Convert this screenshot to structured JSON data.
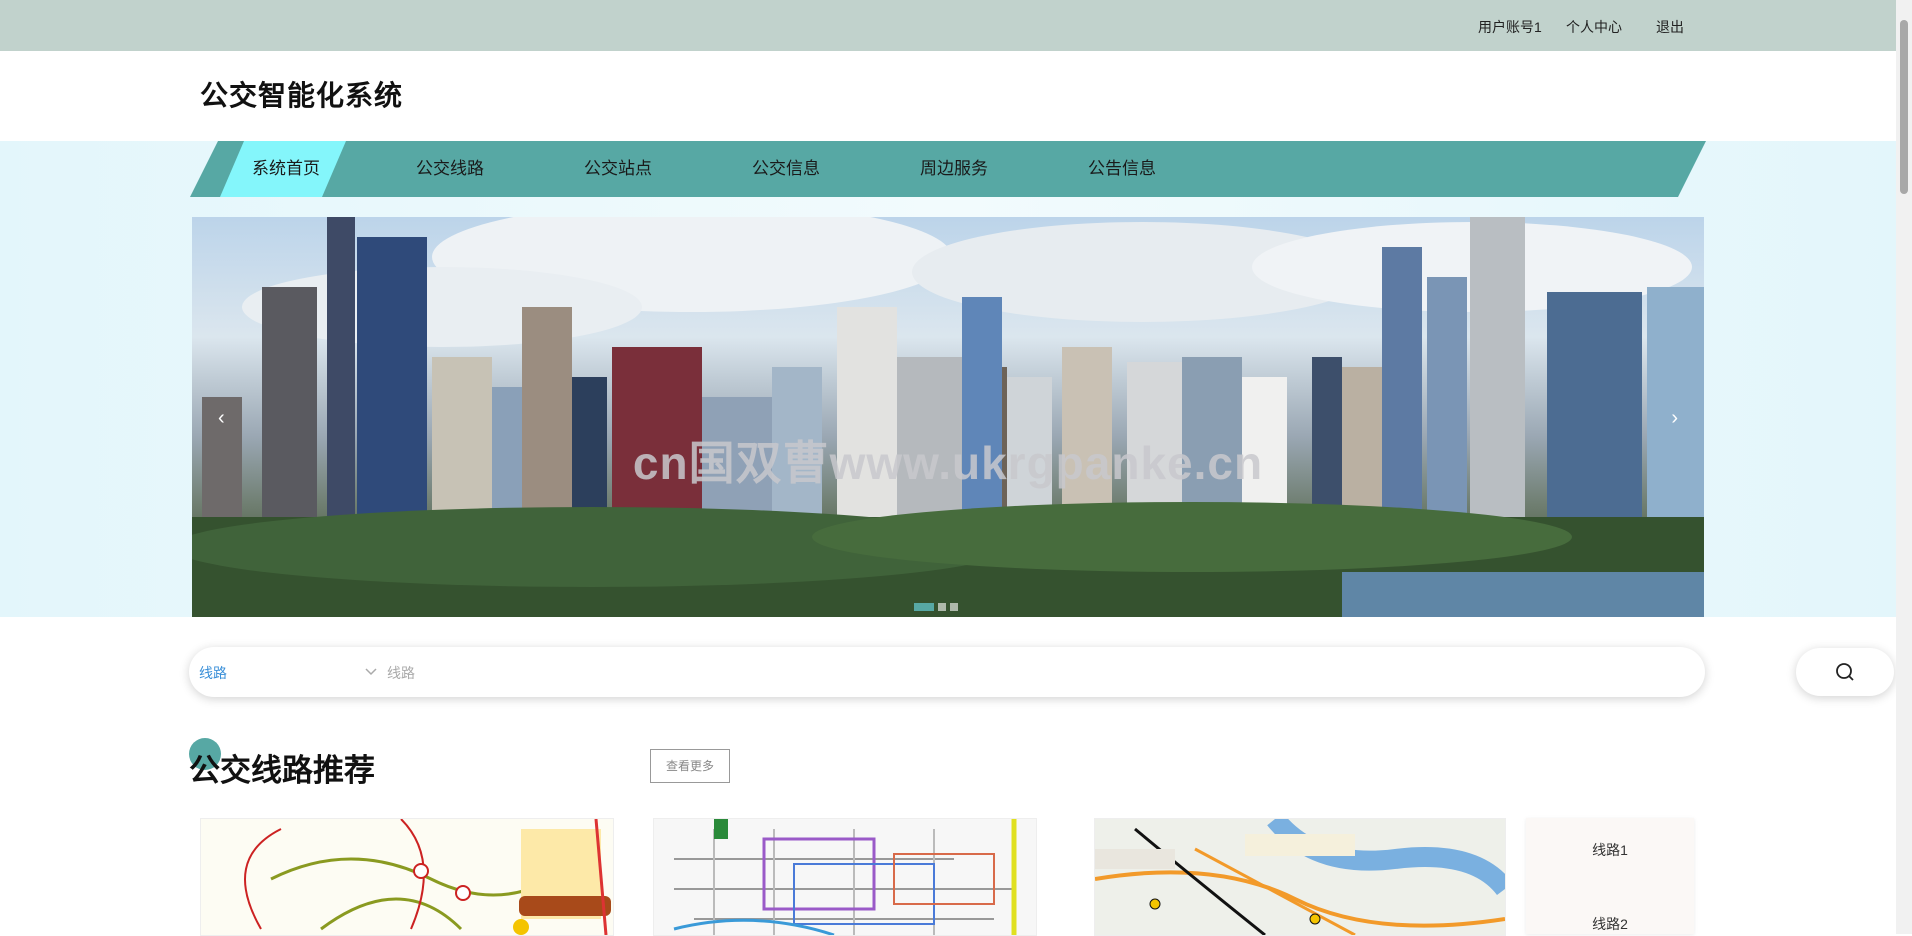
{
  "topbar": {
    "user_account": "用户账号1",
    "profile": "个人中心",
    "logout": "退出"
  },
  "header": {
    "title": "公交智能化系统"
  },
  "nav": {
    "items": [
      {
        "label": "系统首页",
        "active": true
      },
      {
        "label": "公交线路",
        "active": false
      },
      {
        "label": "公交站点",
        "active": false
      },
      {
        "label": "公交信息",
        "active": false
      },
      {
        "label": "周边服务",
        "active": false
      },
      {
        "label": "公告信息",
        "active": false
      }
    ]
  },
  "banner": {
    "watermark": "cn国双曹www.ukrgpanke.cn",
    "prev_arrow": "‹",
    "next_arrow": "›",
    "slide_count": 3,
    "active_slide": 1
  },
  "search": {
    "type_selected": "线路",
    "placeholder": "线路",
    "icon": "search-icon"
  },
  "section": {
    "title": "公交线路推荐",
    "more_label": "查看更多",
    "cards": [
      "route-map-1",
      "route-map-2",
      "route-map-3"
    ],
    "list": [
      "线路1",
      "线路2"
    ]
  },
  "colors": {
    "topbar": "#c1d2cc",
    "nav": "#57a8a4",
    "nav_active": "#84f6fb",
    "accent_link": "#3a8fd8"
  }
}
